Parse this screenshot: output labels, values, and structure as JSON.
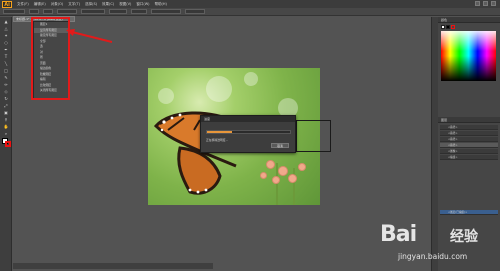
{
  "app": {
    "logo": "Ai",
    "menu": [
      "文件(F)",
      "编辑(E)",
      "对象(O)",
      "文字(T)",
      "选择(S)",
      "效果(C)",
      "视图(V)",
      "窗口(W)",
      "帮助(H)"
    ]
  },
  "document": {
    "tab_label": "未标题-1* @ 66.67% (RGB/预览)"
  },
  "layers_dropdown": {
    "items": [
      "图层1",
      "显示所有图层",
      "锁定所有图层",
      "全部",
      "选",
      "对",
      "所",
      "页面",
      "描边颜色",
      "隐藏图层",
      "编辑",
      "比较图层",
      "关闭所有图层"
    ]
  },
  "dialog": {
    "title": "进度",
    "status": "正在移除透明度...",
    "progress": 0.3,
    "cancel_label": "取消"
  },
  "right_panel": {
    "color_tab": "颜色",
    "layers_tab": "图层",
    "layers": [
      "<路径>",
      "<路径>",
      "<路径>",
      "<路径>",
      "<图像>",
      "<编组>"
    ],
    "current_layer": "<图层(已编组)>"
  },
  "colors": {
    "accent": "#e21a1a",
    "progress": "#e8963a",
    "app_bg": "#535353"
  },
  "watermark": {
    "logo": "Bai",
    "logo_tail": "经验",
    "url": "jingyan.baidu.com"
  }
}
